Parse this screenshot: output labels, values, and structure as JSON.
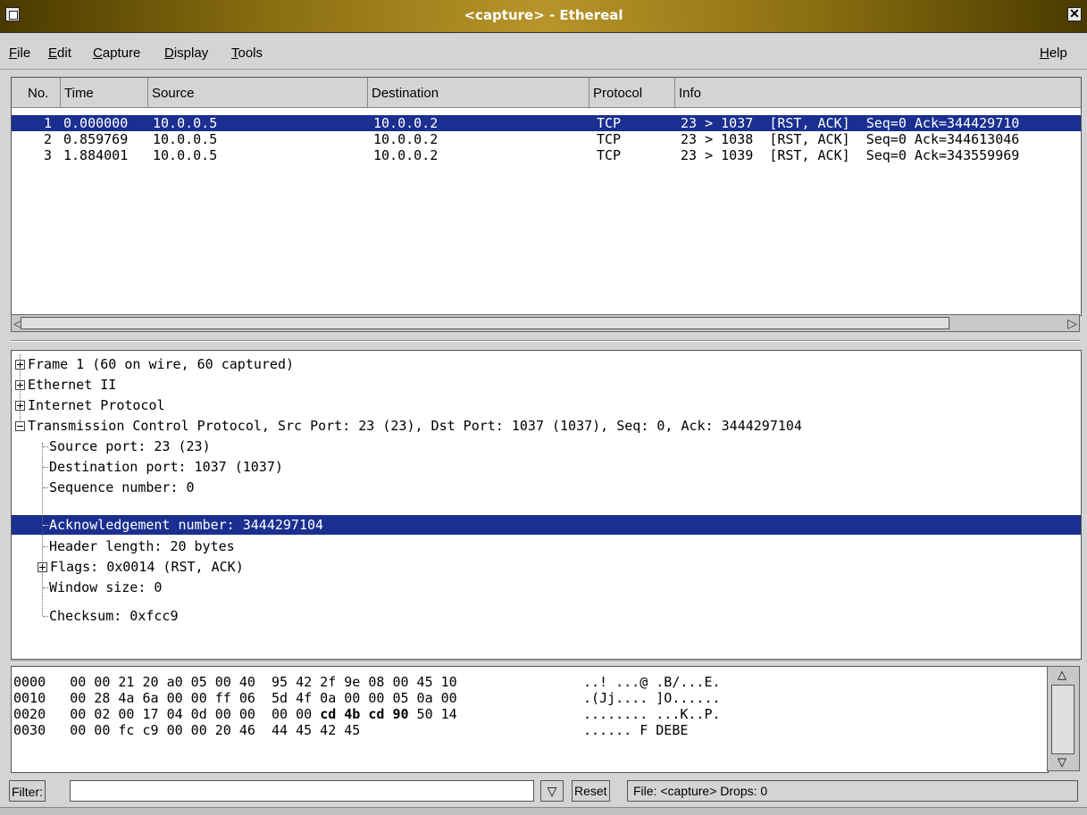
{
  "window": {
    "title": "<capture> - Ethereal"
  },
  "menu": {
    "file": "File",
    "edit": "Edit",
    "capture": "Capture",
    "display": "Display",
    "tools": "Tools",
    "help": "Help"
  },
  "packet_list": {
    "columns": [
      "No.",
      "Time",
      "Source",
      "Destination",
      "Protocol",
      "Info"
    ],
    "rows": [
      {
        "no": "1",
        "time": "0.000000",
        "source": "10.0.0.5",
        "destination": "10.0.0.2",
        "protocol": "TCP",
        "info": "23 > 1037  [RST, ACK]  Seq=0 Ack=344429710",
        "selected": true
      },
      {
        "no": "2",
        "time": "0.859769",
        "source": "10.0.0.5",
        "destination": "10.0.0.2",
        "protocol": "TCP",
        "info": "23 > 1038  [RST, ACK]  Seq=0 Ack=344613046",
        "selected": false
      },
      {
        "no": "3",
        "time": "1.884001",
        "source": "10.0.0.5",
        "destination": "10.0.0.2",
        "protocol": "TCP",
        "info": "23 > 1039  [RST, ACK]  Seq=0 Ack=343559969",
        "selected": false
      }
    ]
  },
  "detail": {
    "frame": "Frame 1 (60 on wire, 60 captured)",
    "ethernet": "Ethernet II",
    "ip": "Internet Protocol",
    "tcp": "Transmission Control Protocol, Src Port: 23 (23), Dst Port: 1037 (1037), Seq: 0, Ack: 3444297104",
    "tcp_children": [
      "Source port: 23 (23)",
      "Destination port: 1037 (1037)",
      "Sequence number: 0",
      "Acknowledgement number: 3444297104",
      "Header length: 20 bytes",
      "Flags: 0x0014 (RST, ACK)",
      "Window size: 0",
      "Checksum: 0xfcc9"
    ]
  },
  "hex": {
    "lines": [
      {
        "offset": "0000",
        "pre": "00 00 21 20 a0 05 00 40  95 42 2f 9e 08 00 45 10",
        "bold": "",
        "post": "",
        "ascii": "..! ...@ .B/...E."
      },
      {
        "offset": "0010",
        "pre": "00 28 4a 6a 00 00 ff 06  5d 4f 0a 00 00 05 0a 00",
        "bold": "",
        "post": "",
        "ascii": ".(Jj.... ]O......"
      },
      {
        "offset": "0020",
        "pre": "00 02 00 17 04 0d 00 00  00 00 ",
        "bold": "cd 4b cd 90",
        "post": " 50 14",
        "ascii": "........ ...K..P."
      },
      {
        "offset": "0030",
        "pre": "00 00 fc c9 00 00 20 46  44 45 42 45",
        "bold": "",
        "post": "",
        "ascii": "...... F DEBE"
      }
    ]
  },
  "statusbar": {
    "filter_label": "Filter:",
    "filter_value": "",
    "reset_label": "Reset",
    "status": "File: <capture>  Drops: 0"
  }
}
